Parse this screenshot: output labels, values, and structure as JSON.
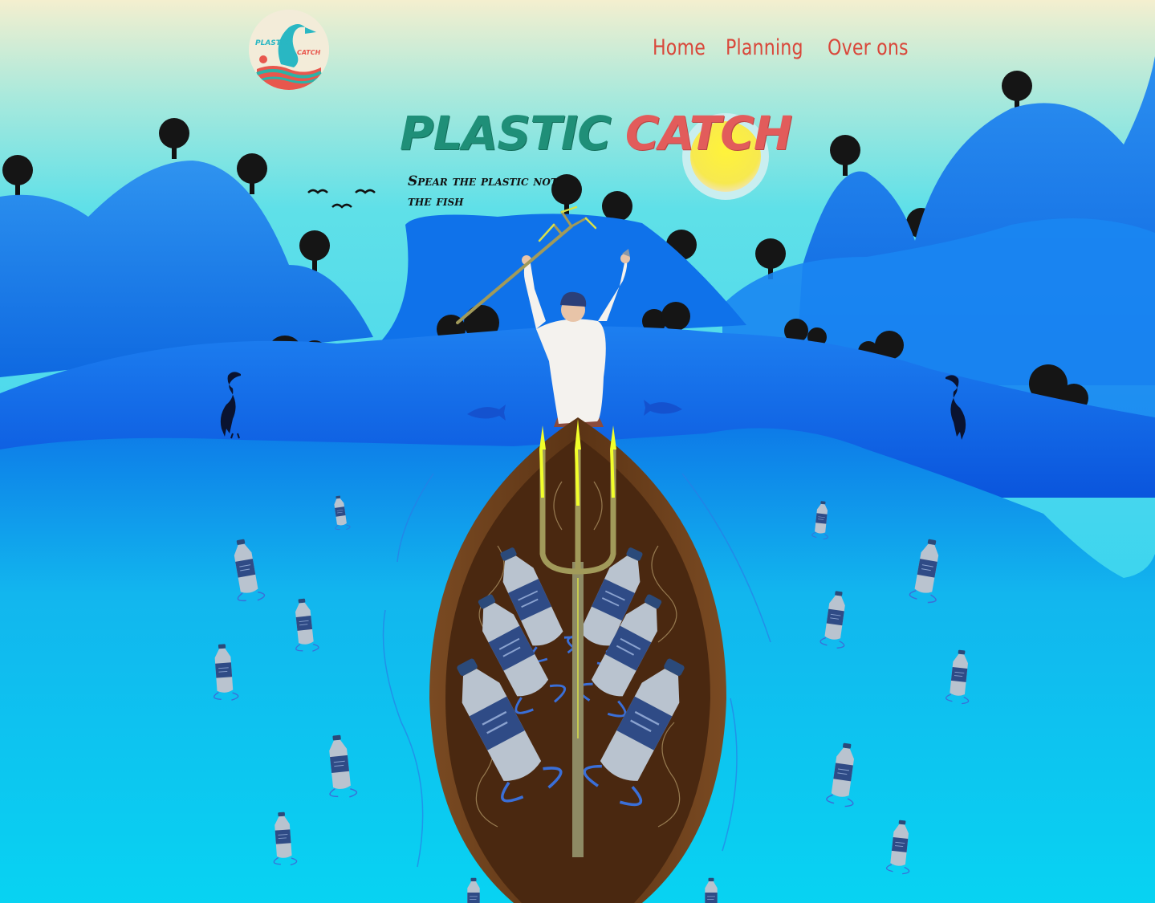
{
  "brand": {
    "logo_top_text": "PLASTIC",
    "logo_bottom_text": "CATCH"
  },
  "nav": {
    "items": [
      {
        "label": "Home"
      },
      {
        "label": "Planning"
      },
      {
        "label": "Over ons"
      }
    ]
  },
  "hero": {
    "title_word1": "Plastic",
    "title_word2": "Catch",
    "tagline": "Spear the plastic not the fish"
  },
  "colors": {
    "accent_red": "#d9473a",
    "title_green": "#1f8f78",
    "title_red": "#e25c5b",
    "hill_blue": "#0b6fe9",
    "water_cyan": "#1ad2f0",
    "boat_brown": "#6b3f1d"
  },
  "icons": [
    "heron-logo-icon",
    "sun-icon",
    "bird-icon",
    "heron-icon",
    "fish-icon",
    "bottle-icon",
    "trident-icon",
    "boat-icon",
    "fisherman-icon",
    "tree-icon"
  ]
}
